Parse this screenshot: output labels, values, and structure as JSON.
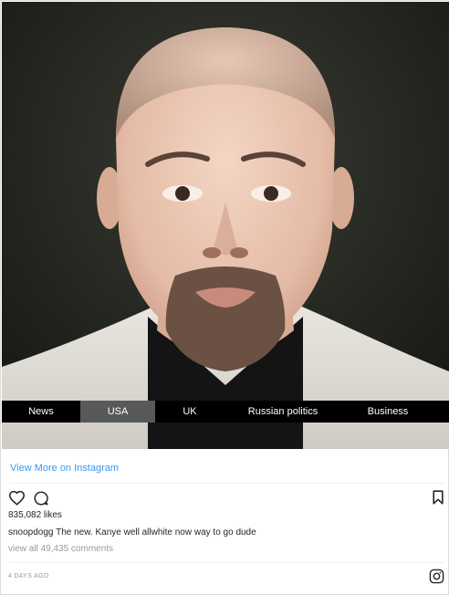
{
  "nav": {
    "items": [
      {
        "label": "News",
        "active": false
      },
      {
        "label": "USA",
        "active": true
      },
      {
        "label": "UK",
        "active": false
      },
      {
        "label": "Russian politics",
        "active": false
      },
      {
        "label": "Business",
        "active": false
      }
    ]
  },
  "embed": {
    "view_more": "View More on Instagram",
    "likes": "835,082 likes",
    "username": "snoopdogg",
    "caption": "The new. Kanye well allwhite now way to go dude",
    "comments": "view all 49,435 comments",
    "timestamp": "4 DAYS AGO"
  },
  "icons": {
    "like": "heart-icon",
    "comment": "comment-icon",
    "save": "bookmark-icon",
    "brand": "instagram-icon"
  },
  "colors": {
    "link": "#3897f0",
    "nav_bg": "#000000",
    "nav_active": "#58595b",
    "muted_text": "#999999"
  }
}
